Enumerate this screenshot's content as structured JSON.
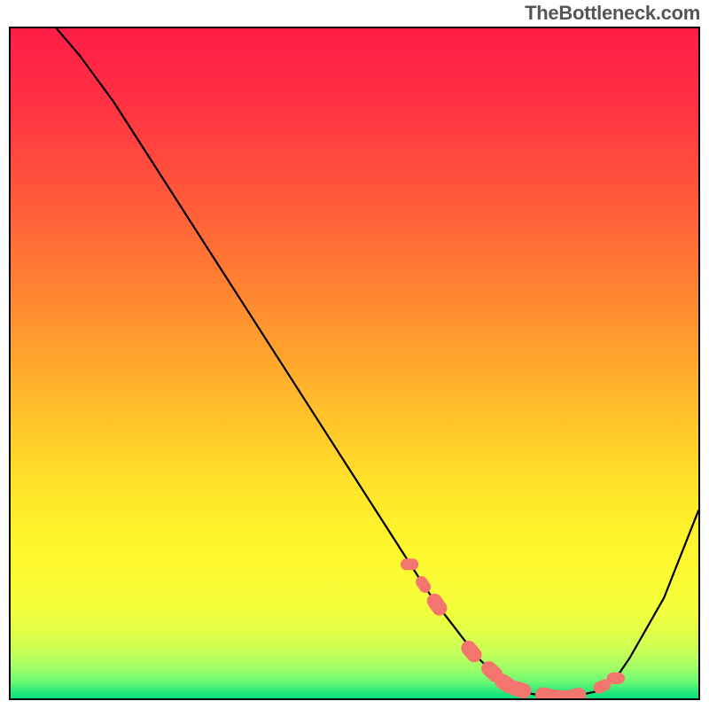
{
  "watermark": "TheBottleneck.com",
  "colors": {
    "curve": "#000000",
    "marker_stroke": "#ff6f6f",
    "marker_fill": "#f3766e",
    "border": "#000000"
  },
  "gradient_stops": [
    {
      "offset": 0.0,
      "color": "#ff1d46"
    },
    {
      "offset": 0.1,
      "color": "#ff2f44"
    },
    {
      "offset": 0.2,
      "color": "#ff4a3e"
    },
    {
      "offset": 0.3,
      "color": "#ff6737"
    },
    {
      "offset": 0.4,
      "color": "#ff8731"
    },
    {
      "offset": 0.5,
      "color": "#ffa82d"
    },
    {
      "offset": 0.6,
      "color": "#ffc92a"
    },
    {
      "offset": 0.7,
      "color": "#ffe82a"
    },
    {
      "offset": 0.78,
      "color": "#fff72e"
    },
    {
      "offset": 0.86,
      "color": "#f5ff3a"
    },
    {
      "offset": 0.9,
      "color": "#e3ff48"
    },
    {
      "offset": 0.93,
      "color": "#c7ff57"
    },
    {
      "offset": 0.955,
      "color": "#9fff66"
    },
    {
      "offset": 0.975,
      "color": "#6cf874"
    },
    {
      "offset": 0.99,
      "color": "#28ea7a"
    },
    {
      "offset": 1.0,
      "color": "#0be17d"
    }
  ],
  "chart_data": {
    "type": "line",
    "title": "",
    "xlabel": "",
    "ylabel": "",
    "xlim": [
      0,
      100
    ],
    "ylim": [
      0,
      100
    ],
    "grid": false,
    "series": [
      {
        "name": "curve",
        "x": [
          0,
          5,
          10,
          15,
          20,
          25,
          30,
          35,
          40,
          45,
          50,
          55,
          60,
          62,
          65,
          68,
          70,
          72,
          75,
          78,
          80,
          82,
          85,
          88,
          90,
          95,
          100
        ],
        "y": [
          106,
          102,
          96,
          89,
          81,
          73,
          65,
          57,
          49,
          41,
          33,
          25,
          17,
          14,
          10,
          6,
          4,
          2,
          0.8,
          0.3,
          0,
          0.3,
          1,
          3,
          6,
          15,
          28
        ]
      }
    ],
    "markers": {
      "name": "highlighted-points",
      "x": [
        58,
        60,
        62,
        67,
        70,
        72,
        74,
        78,
        80,
        82,
        86,
        88
      ],
      "y": [
        20,
        17,
        14,
        7,
        4,
        2.2,
        1.3,
        0.4,
        0.1,
        0.3,
        1.8,
        3
      ],
      "size": [
        6,
        6,
        8,
        8,
        8,
        8,
        8,
        8,
        8,
        8,
        6,
        6
      ]
    }
  }
}
